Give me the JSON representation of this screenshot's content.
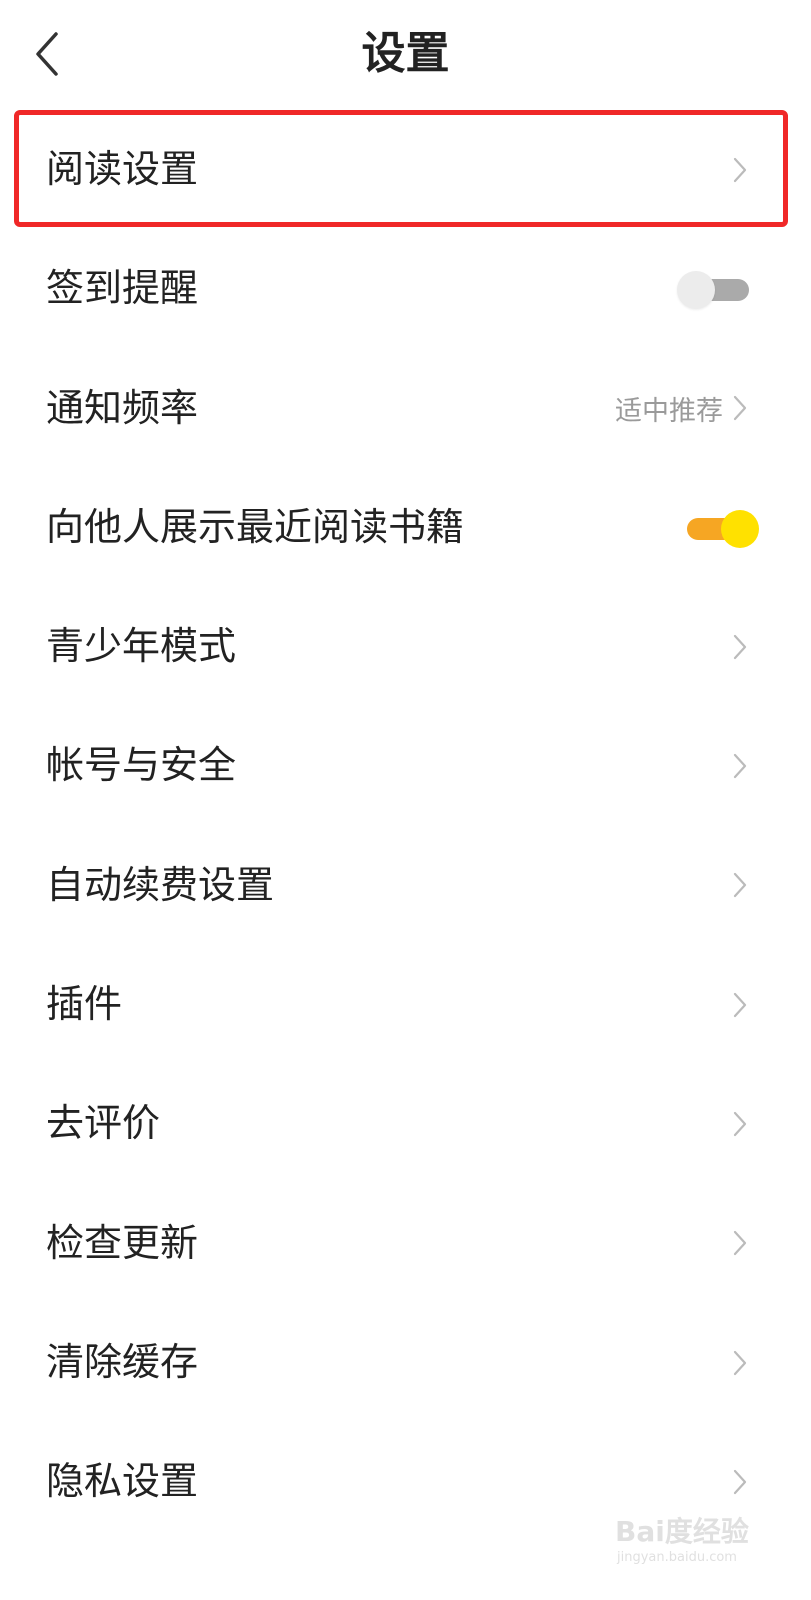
{
  "header": {
    "title": "设置",
    "back_icon": "chevron-left-icon"
  },
  "settings": {
    "items": [
      {
        "label": "阅读设置",
        "type": "link",
        "highlighted": true
      },
      {
        "label": "签到提醒",
        "type": "toggle",
        "enabled": false
      },
      {
        "label": "通知频率",
        "type": "link",
        "value": "适中推荐"
      },
      {
        "label": "向他人展示最近阅读书籍",
        "type": "toggle",
        "enabled": true
      },
      {
        "label": "青少年模式",
        "type": "link"
      },
      {
        "label": "帐号与安全",
        "type": "link"
      },
      {
        "label": "自动续费设置",
        "type": "link"
      },
      {
        "label": "插件",
        "type": "link"
      },
      {
        "label": "去评价",
        "type": "link"
      },
      {
        "label": "检查更新",
        "type": "link"
      },
      {
        "label": "清除缓存",
        "type": "link"
      },
      {
        "label": "隐私设置",
        "type": "link"
      }
    ]
  },
  "colors": {
    "highlight_border": "#f02828",
    "toggle_on_track": "#f6a623",
    "toggle_on_knob": "#ffe100",
    "toggle_off_track": "#aaaaaa",
    "toggle_off_knob": "#ececec",
    "chevron": "#bbbbbb",
    "secondary_text": "#9a9a9a"
  },
  "watermark": {
    "logo": "Bai度经验",
    "url": "jingyan.baidu.com"
  }
}
